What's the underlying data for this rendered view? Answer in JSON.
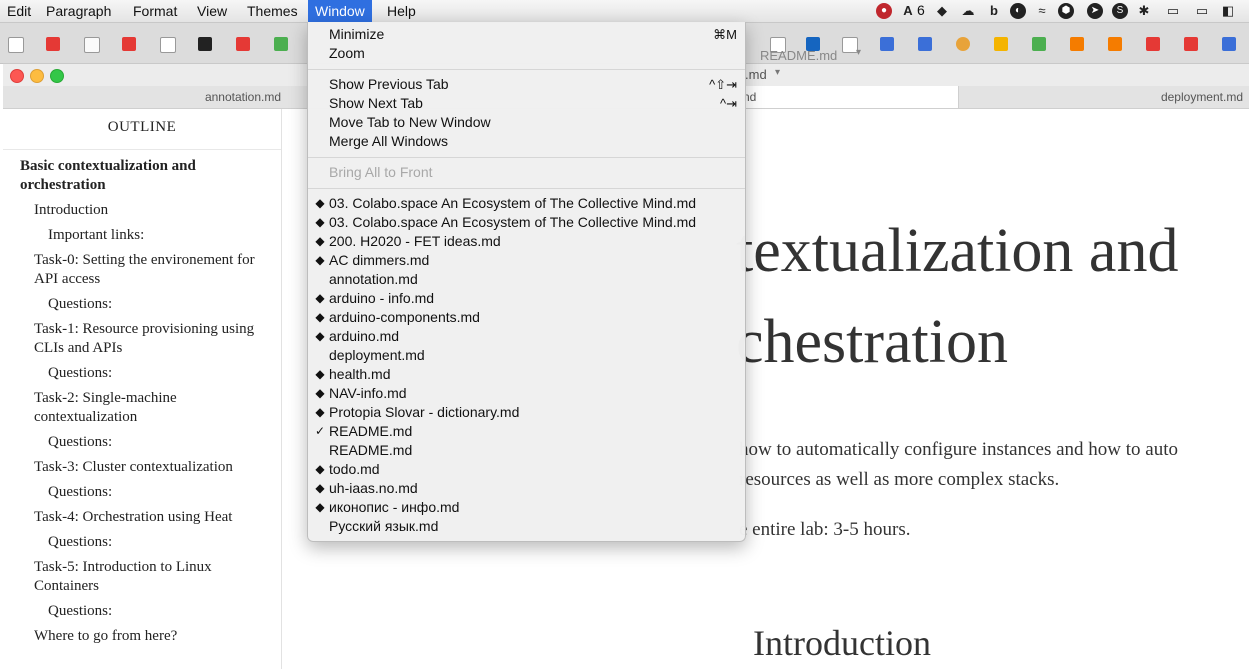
{
  "menubar": {
    "items": [
      "Edit",
      "Paragraph",
      "Format",
      "View",
      "Themes",
      "Window",
      "Help"
    ],
    "active": "Window",
    "tray": {
      "badge_count": "6"
    }
  },
  "window": {
    "tabs": [
      {
        "label": "annotation.md"
      },
      {
        "label": "nd"
      },
      {
        "label": "deployment.md"
      }
    ],
    "background_headers": [
      "README.md",
      ".md"
    ]
  },
  "outline": {
    "title": "OUTLINE",
    "items": [
      {
        "label": "Basic contextualization and orchestration",
        "level": 0
      },
      {
        "label": "Introduction",
        "level": 1
      },
      {
        "label": "Important links:",
        "level": 2
      },
      {
        "label": "Task-0: Setting the environement for API access",
        "level": 1
      },
      {
        "label": "Questions:",
        "level": 2
      },
      {
        "label": "Task-1: Resource provisioning using CLIs and APIs",
        "level": 1
      },
      {
        "label": "Questions:",
        "level": 2
      },
      {
        "label": "Task-2: Single-machine contextualization",
        "level": 1
      },
      {
        "label": "Questions:",
        "level": 2
      },
      {
        "label": "Task-3: Cluster contextualization",
        "level": 1
      },
      {
        "label": "Questions:",
        "level": 2
      },
      {
        "label": "Task-4: Orchestration using Heat",
        "level": 1
      },
      {
        "label": "Questions:",
        "level": 2
      },
      {
        "label": "Task-5: Introduction to Linux Containers",
        "level": 1
      },
      {
        "label": "Questions:",
        "level": 2
      },
      {
        "label": "Where to go from here?",
        "level": 1
      }
    ]
  },
  "editor": {
    "heading_line1": "textualization and",
    "heading_line2": "chestration",
    "para_line1": "how to automatically configure instances and how to auto",
    "para_line2": "resources as well as more complex stacks.",
    "para_line3": "e entire lab: 3-5 hours.",
    "section_heading": "Introduction"
  },
  "window_menu": {
    "group1": [
      {
        "label": "Minimize",
        "shortcut": "⌘M"
      },
      {
        "label": "Zoom",
        "shortcut": ""
      }
    ],
    "group2": [
      {
        "label": "Show Previous Tab",
        "shortcut": "^⇧⇥"
      },
      {
        "label": "Show Next Tab",
        "shortcut": "^⇥"
      },
      {
        "label": "Move Tab to New Window",
        "shortcut": ""
      },
      {
        "label": "Merge All Windows",
        "shortcut": ""
      }
    ],
    "group3": [
      {
        "label": "Bring All to Front",
        "disabled": true
      }
    ],
    "documents": [
      {
        "label": "03. Colabo.space An Ecosystem of The Collective Mind.md",
        "mark": "◆"
      },
      {
        "label": "03. Colabo.space An Ecosystem of The Collective Mind.md",
        "mark": "◆"
      },
      {
        "label": "200. H2020 - FET ideas.md",
        "mark": "◆"
      },
      {
        "label": "AC dimmers.md",
        "mark": "◆"
      },
      {
        "label": "annotation.md",
        "mark": ""
      },
      {
        "label": "arduino - info.md",
        "mark": "◆"
      },
      {
        "label": "arduino-components.md",
        "mark": "◆"
      },
      {
        "label": "arduino.md",
        "mark": "◆"
      },
      {
        "label": "deployment.md",
        "mark": ""
      },
      {
        "label": "health.md",
        "mark": "◆"
      },
      {
        "label": "NAV-info.md",
        "mark": "◆"
      },
      {
        "label": "Protopia Slovar - dictionary.md",
        "mark": "◆"
      },
      {
        "label": "README.md",
        "mark": "✓"
      },
      {
        "label": "README.md",
        "mark": ""
      },
      {
        "label": "todo.md",
        "mark": "◆"
      },
      {
        "label": "uh-iaas.no.md",
        "mark": "◆"
      },
      {
        "label": "иконопис - инфо.md",
        "mark": "◆"
      },
      {
        "label": "Русский язык.md",
        "mark": ""
      }
    ]
  },
  "colors": {
    "menu_highlight": "#2f6fe0",
    "traffic_red": "#fc5753",
    "traffic_yellow": "#fdbc40",
    "traffic_green": "#33c748"
  }
}
